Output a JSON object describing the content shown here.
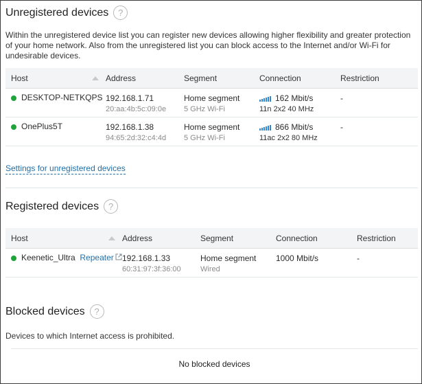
{
  "unregistered": {
    "title": "Unregistered devices",
    "description": "Within the unregistered device list you can register new devices allowing higher flexibility and greater protection of your home network. Also from the unregistered list you can block access to the Internet and/or Wi-Fi for undesirable devices.",
    "columns": [
      "Host",
      "Address",
      "Segment",
      "Connection",
      "Restriction"
    ],
    "rows": [
      {
        "host": "DESKTOP-NETKQPS",
        "ip": "192.168.1.71",
        "mac": "20:aa:4b:5c:09:0e",
        "segment": "Home segment",
        "segment_sub": "5 GHz Wi-Fi",
        "speed": "162 Mbit/s",
        "mode": "11n 2x2 40 MHz",
        "restriction": "-",
        "status_color": "#20a33a"
      },
      {
        "host": "OnePlus5T",
        "ip": "192.168.1.38",
        "mac": "94:65:2d:32:c4:4d",
        "segment": "Home segment",
        "segment_sub": "5 GHz Wi-Fi",
        "speed": "866 Mbit/s",
        "mode": "11ac 2x2 80 MHz",
        "restriction": "-",
        "status_color": "#20a33a"
      }
    ],
    "settings_link": "Settings for unregistered devices"
  },
  "registered": {
    "title": "Registered devices",
    "columns": [
      "Host",
      "Address",
      "Segment",
      "Connection",
      "Restriction"
    ],
    "rows": [
      {
        "host": "Keenetic_Ultra",
        "tag": "Repeater",
        "ip": "192.168.1.33",
        "mac": "60:31:97:3f:36:00",
        "segment": "Home segment",
        "segment_sub": "Wired",
        "speed": "1000 Mbit/s",
        "restriction": "-",
        "status_color": "#20a33a"
      }
    ]
  },
  "blocked": {
    "title": "Blocked devices",
    "description": "Devices to which Internet access is prohibited.",
    "empty_text": "No blocked devices"
  },
  "icons": {
    "help": "question-circle-icon",
    "sort": "sort-up-icon",
    "signal": "wifi-signal-bars-icon",
    "external": "external-link-icon"
  },
  "colors": {
    "accent": "#1f6fa8",
    "online": "#20a33a",
    "signal": "#2e86d1"
  }
}
